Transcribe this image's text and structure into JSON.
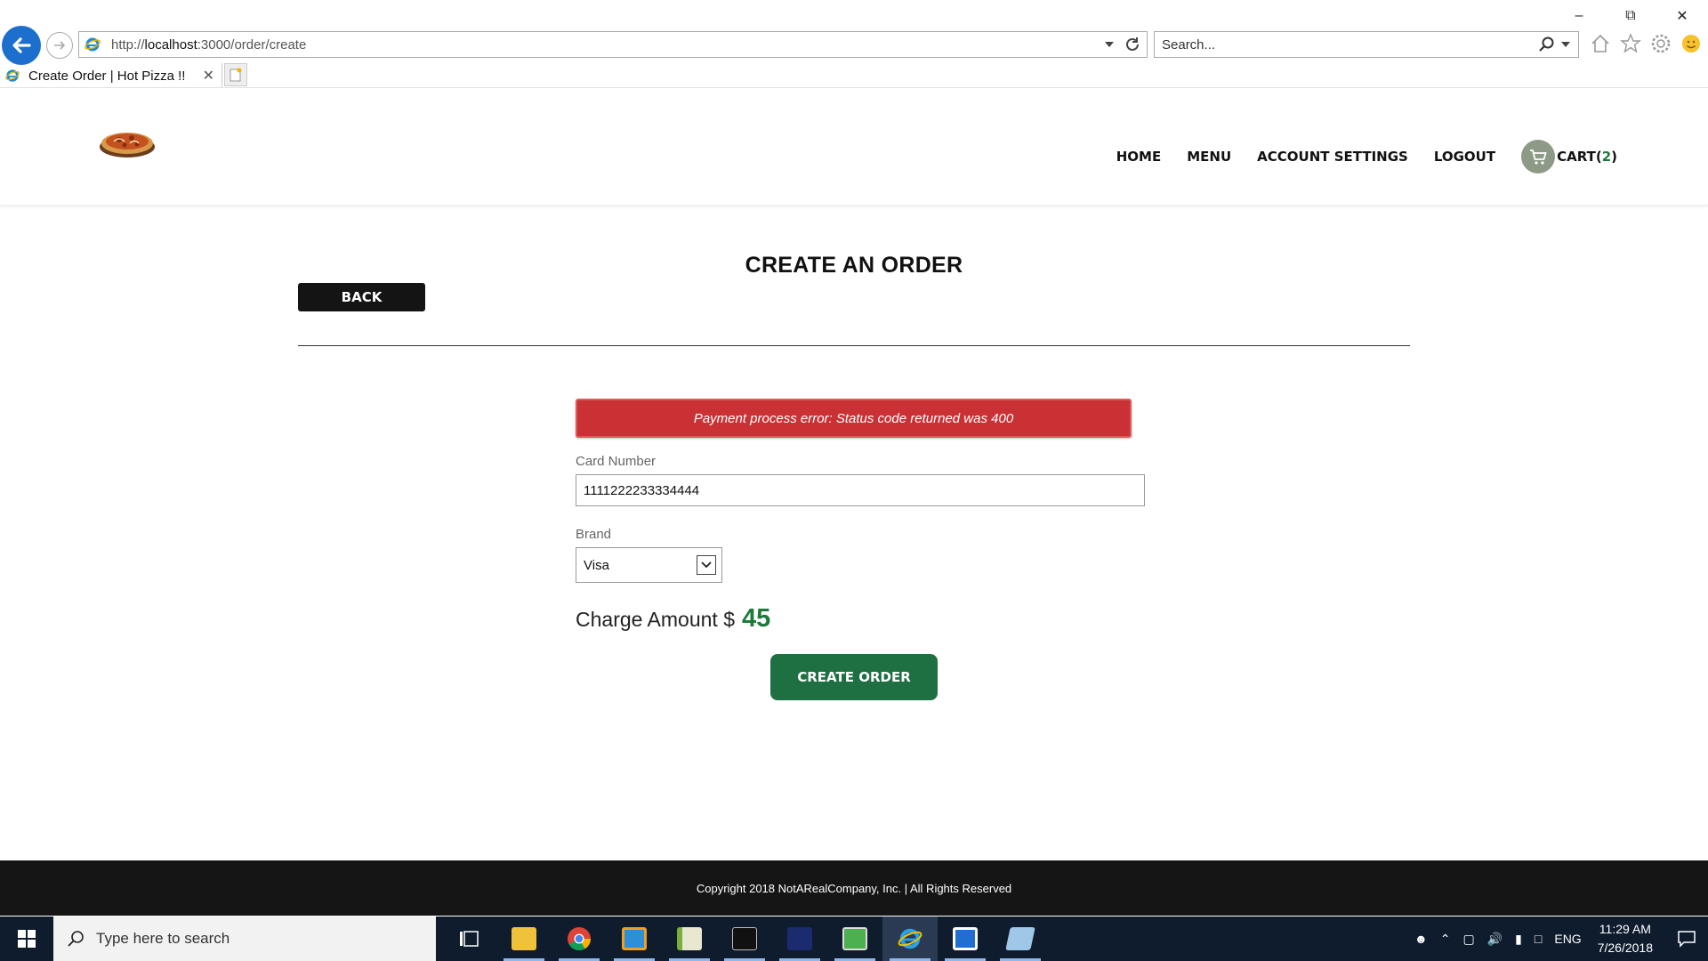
{
  "browser": {
    "url_prefix": "http://",
    "url_host": "localhost",
    "url_rest": ":3000/order/create",
    "search_placeholder": "Search...",
    "tab_title": "Create Order | Hot Pizza !!"
  },
  "nav": {
    "home": "HOME",
    "menu": "MENU",
    "account_settings": "ACCOUNT SETTINGS",
    "logout": "LOGOUT",
    "cart_label": "CART(",
    "cart_count": "2",
    "cart_close": ")"
  },
  "page": {
    "title": "CREATE AN ORDER",
    "back_label": "BACK",
    "error_message": "Payment process error: Status code returned was 400",
    "card_number_label": "Card Number",
    "card_number_value": "1111222233334444",
    "brand_label": "Brand",
    "brand_value": "Visa",
    "charge_label": "Charge Amount $",
    "charge_amount": "45",
    "create_order_label": "CREATE ORDER"
  },
  "footer": {
    "copyright": "Copyright 2018 NotARealCompany, Inc. | All Rights Reserved"
  },
  "taskbar": {
    "search_placeholder": "Type here to search",
    "language": "ENG",
    "time": "11:29 AM",
    "date": "7/26/2018"
  },
  "colors": {
    "accent_green": "#1e7043",
    "error_red": "#c93135",
    "ie_blue": "#1c6fcc"
  }
}
